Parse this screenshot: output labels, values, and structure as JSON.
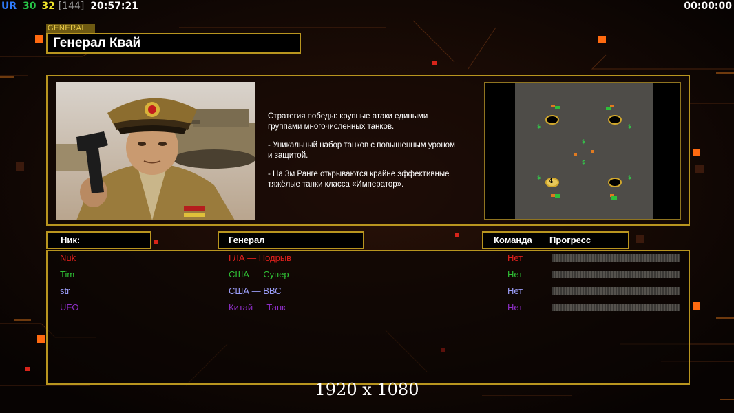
{
  "status_bar": {
    "ur_label": "UR",
    "value_a": "30",
    "value_b": "32",
    "value_c": "[144]",
    "clock": "20:57:21",
    "timer": "00:00:00",
    "colors": {
      "ur": "#2f7cff",
      "a": "#27c447",
      "b": "#f2e62a",
      "c": "#9a9a9a",
      "clock": "#ffffff"
    }
  },
  "general": {
    "tag": "GENERAL",
    "title": "Генерал Квай",
    "portrait_icon": "general-portrait"
  },
  "strategy": {
    "lines": [
      "Стратегия победы: крупные атаки едиными\n группами многочисленных танков.",
      "- Уникальный набор танков с повышенным уроном\n и защитой.",
      "- На 3м Ранге открываются крайне эффективные\n тяжёлые танки класса «Император»."
    ]
  },
  "map": {
    "start_marker_label": "4",
    "icon": "minimap"
  },
  "table": {
    "headers": {
      "nick": "Ник:",
      "general": "Генерал",
      "team": "Команда",
      "progress": "Прогресс"
    },
    "rows": [
      {
        "nick": "Nuk",
        "general": "ГЛА — Подрыв",
        "team": "Нет",
        "progress": 0,
        "color": "#e0201c"
      },
      {
        "nick": "Tim",
        "general": "США — Супер",
        "team": "Нет",
        "progress": 0,
        "color": "#2fbf35"
      },
      {
        "nick": "str",
        "general": "США — ВВС",
        "team": "Нет",
        "progress": 0,
        "color": "#9a9cf6"
      },
      {
        "nick": "UFO",
        "general": "Китай — Танк",
        "team": "Нет",
        "progress": 0,
        "color": "#8f2fc8"
      }
    ]
  },
  "resolution": "1920 x 1080",
  "accent_color": "#b8951f"
}
